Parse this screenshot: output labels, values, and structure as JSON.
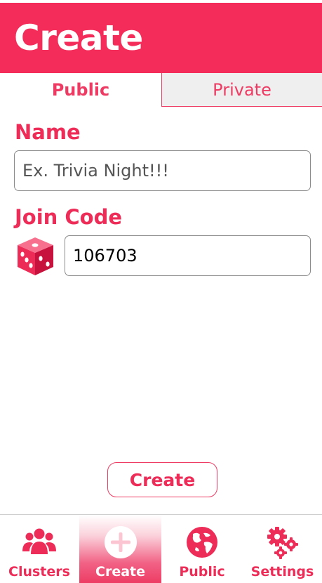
{
  "header": {
    "title": "Create"
  },
  "tabs": [
    {
      "label": "Public",
      "active": true
    },
    {
      "label": "Private",
      "active": false
    }
  ],
  "form": {
    "name_label": "Name",
    "name_placeholder": "Ex. Trivia Night!!!",
    "name_value": "",
    "code_label": "Join Code",
    "code_value": "106703",
    "dice_icon": "dice-icon"
  },
  "actions": {
    "create_label": "Create"
  },
  "nav": {
    "items": [
      {
        "label": "Clusters",
        "icon": "users-icon",
        "active": false
      },
      {
        "label": "Create",
        "icon": "plus-circle-icon",
        "active": true
      },
      {
        "label": "Public",
        "icon": "globe-icon",
        "active": false
      },
      {
        "label": "Settings",
        "icon": "gears-icon",
        "active": false
      }
    ]
  },
  "colors": {
    "accent": "#f42c5a",
    "text_accent": "#ee2c58",
    "tab_inactive_bg": "#efefef"
  }
}
